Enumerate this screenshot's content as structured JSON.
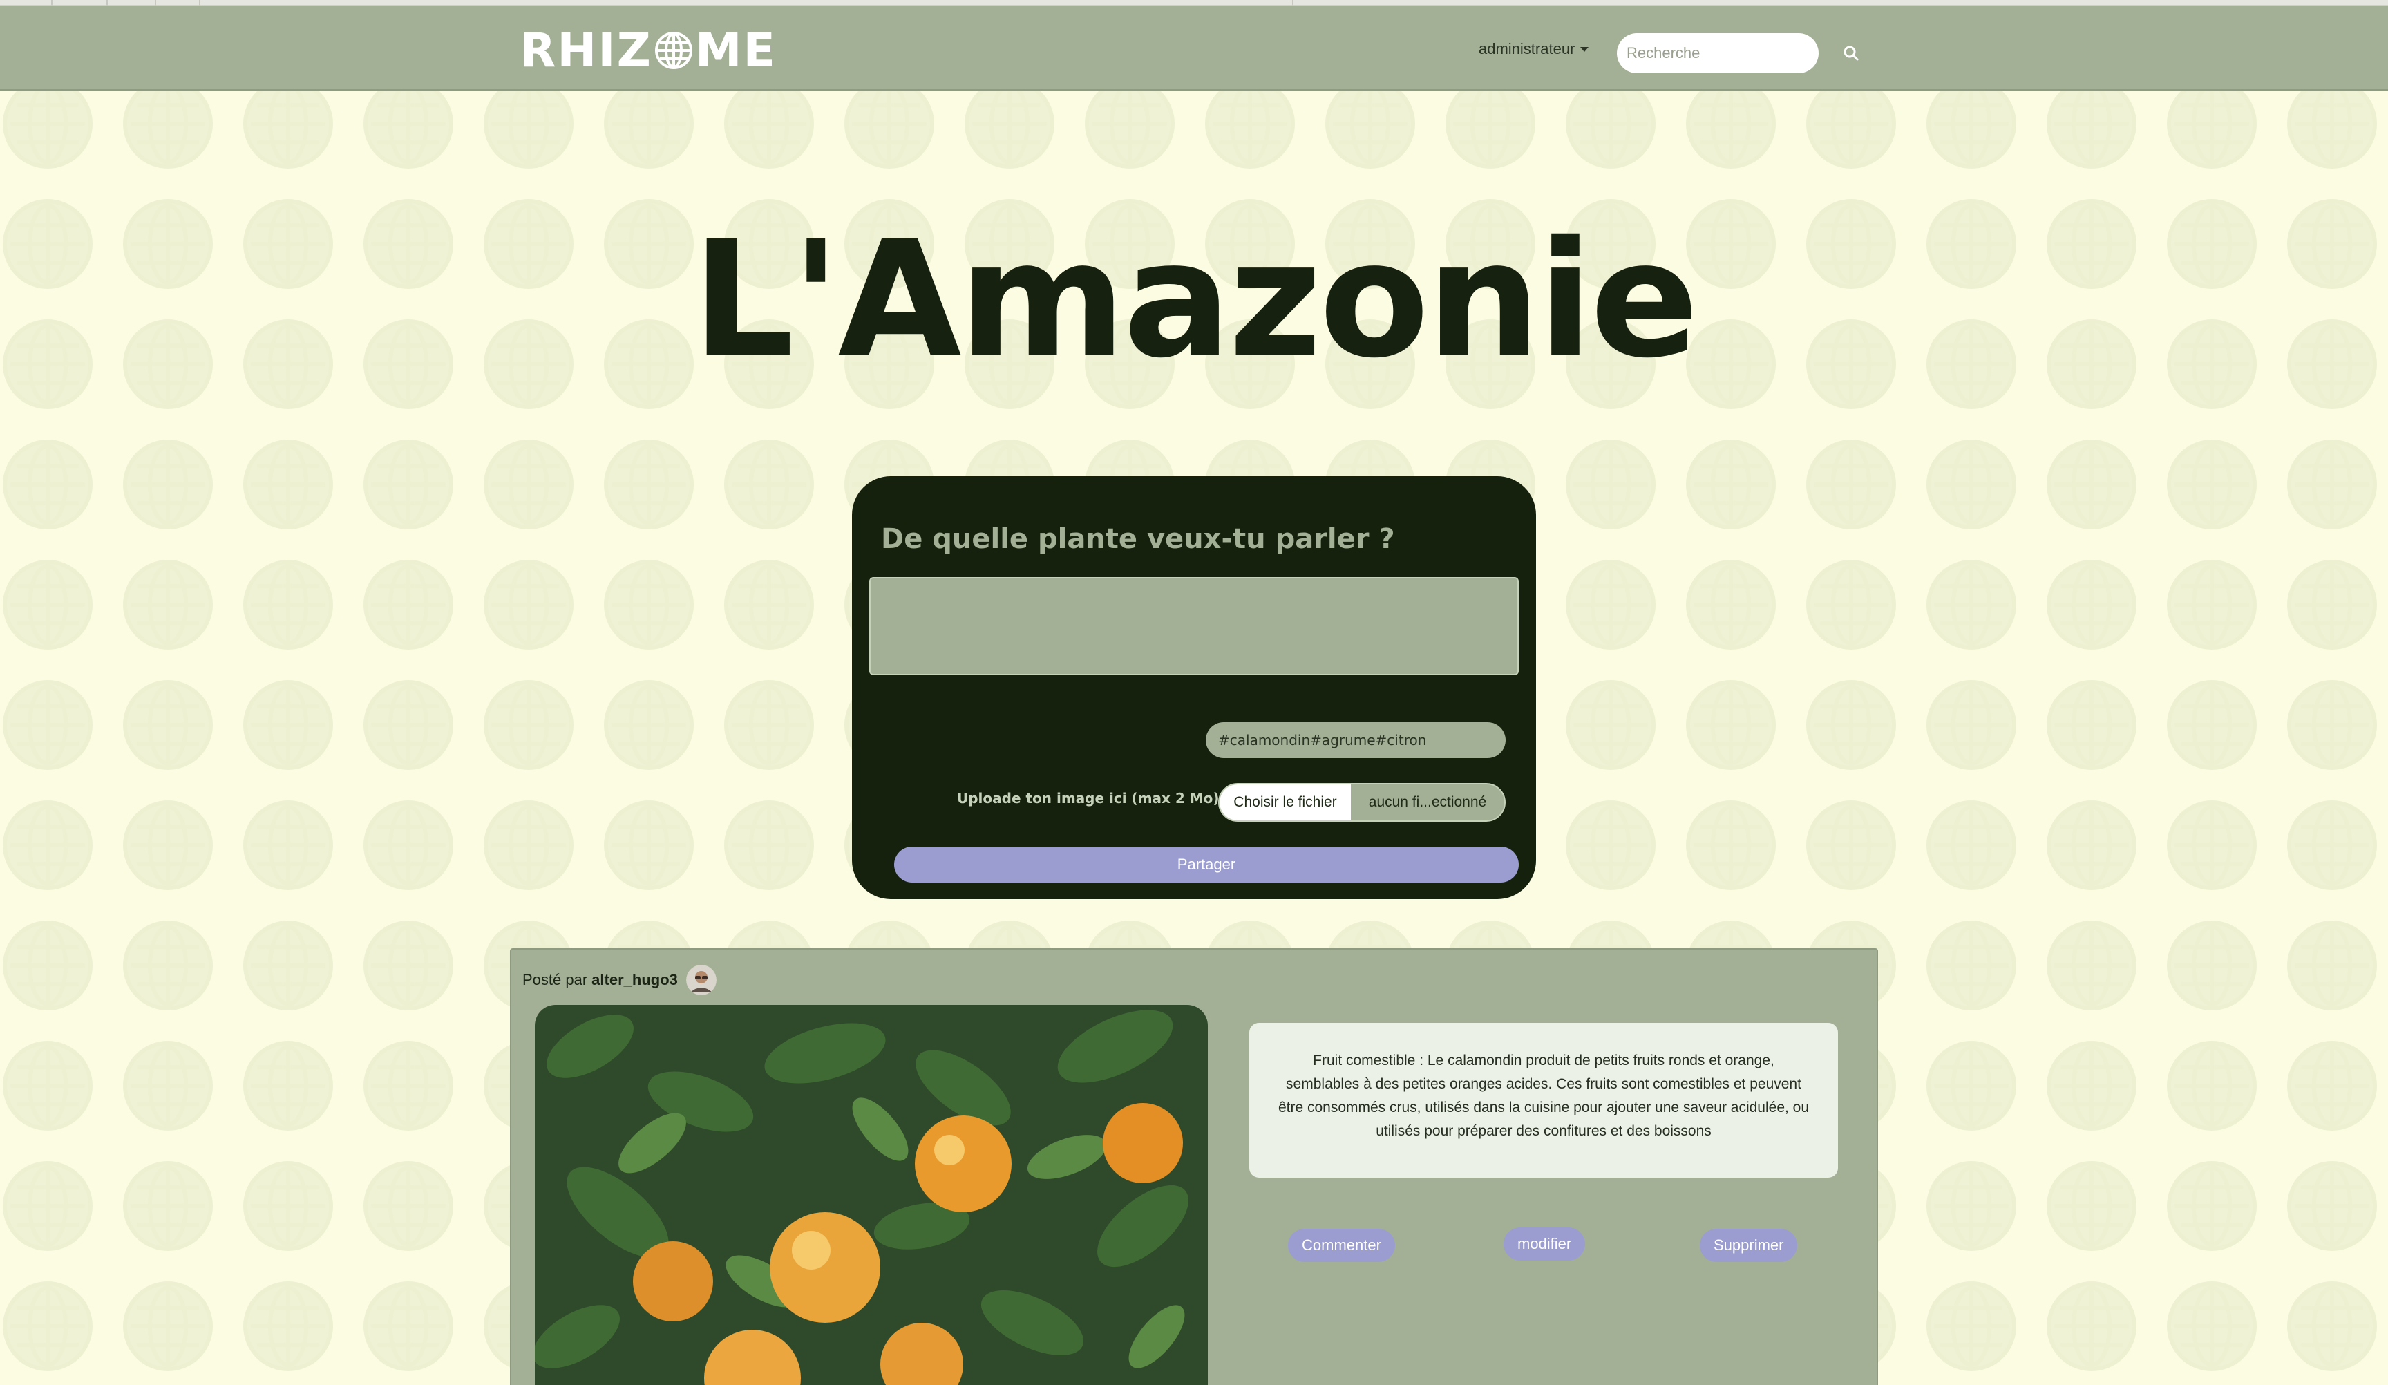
{
  "brand": {
    "logo_text_left": "RHIZ",
    "logo_text_right": "ME"
  },
  "navbar": {
    "user_menu_label": "administrateur",
    "search_placeholder": "Recherche"
  },
  "page": {
    "title": "L'Amazonie"
  },
  "post_form": {
    "question": "De quelle plante veux-tu parler ?",
    "textarea_value": "",
    "tags_value": "#calamondin#agrume#citron",
    "upload_label": "Uploade ton image ici (max 2 Mo)",
    "file_button_label": "Choisir le fichier",
    "file_status": "aucun fi...ectionné",
    "submit_label": "Partager"
  },
  "post": {
    "posted_by_prefix": "Posté par",
    "author": "alter_hugo3",
    "text": "Fruit comestible : Le calamondin produit de petits fruits ronds et orange, semblables à des petites oranges acides. Ces fruits sont comestibles et peuvent être consommés crus, utilisés dans la cuisine pour ajouter une saveur acidulée, ou utilisés pour préparer des confitures et des boissons",
    "actions": {
      "comment": "Commenter",
      "edit": "modifier",
      "delete": "Supprimer"
    }
  },
  "icons": {
    "search": "search-icon",
    "caret": "caret-down-icon",
    "globe": "globe-icon"
  },
  "colors": {
    "background": "#fbfce2",
    "navbar": "#a3b095",
    "dark": "#15200d",
    "accent": "#9b9dd0"
  }
}
